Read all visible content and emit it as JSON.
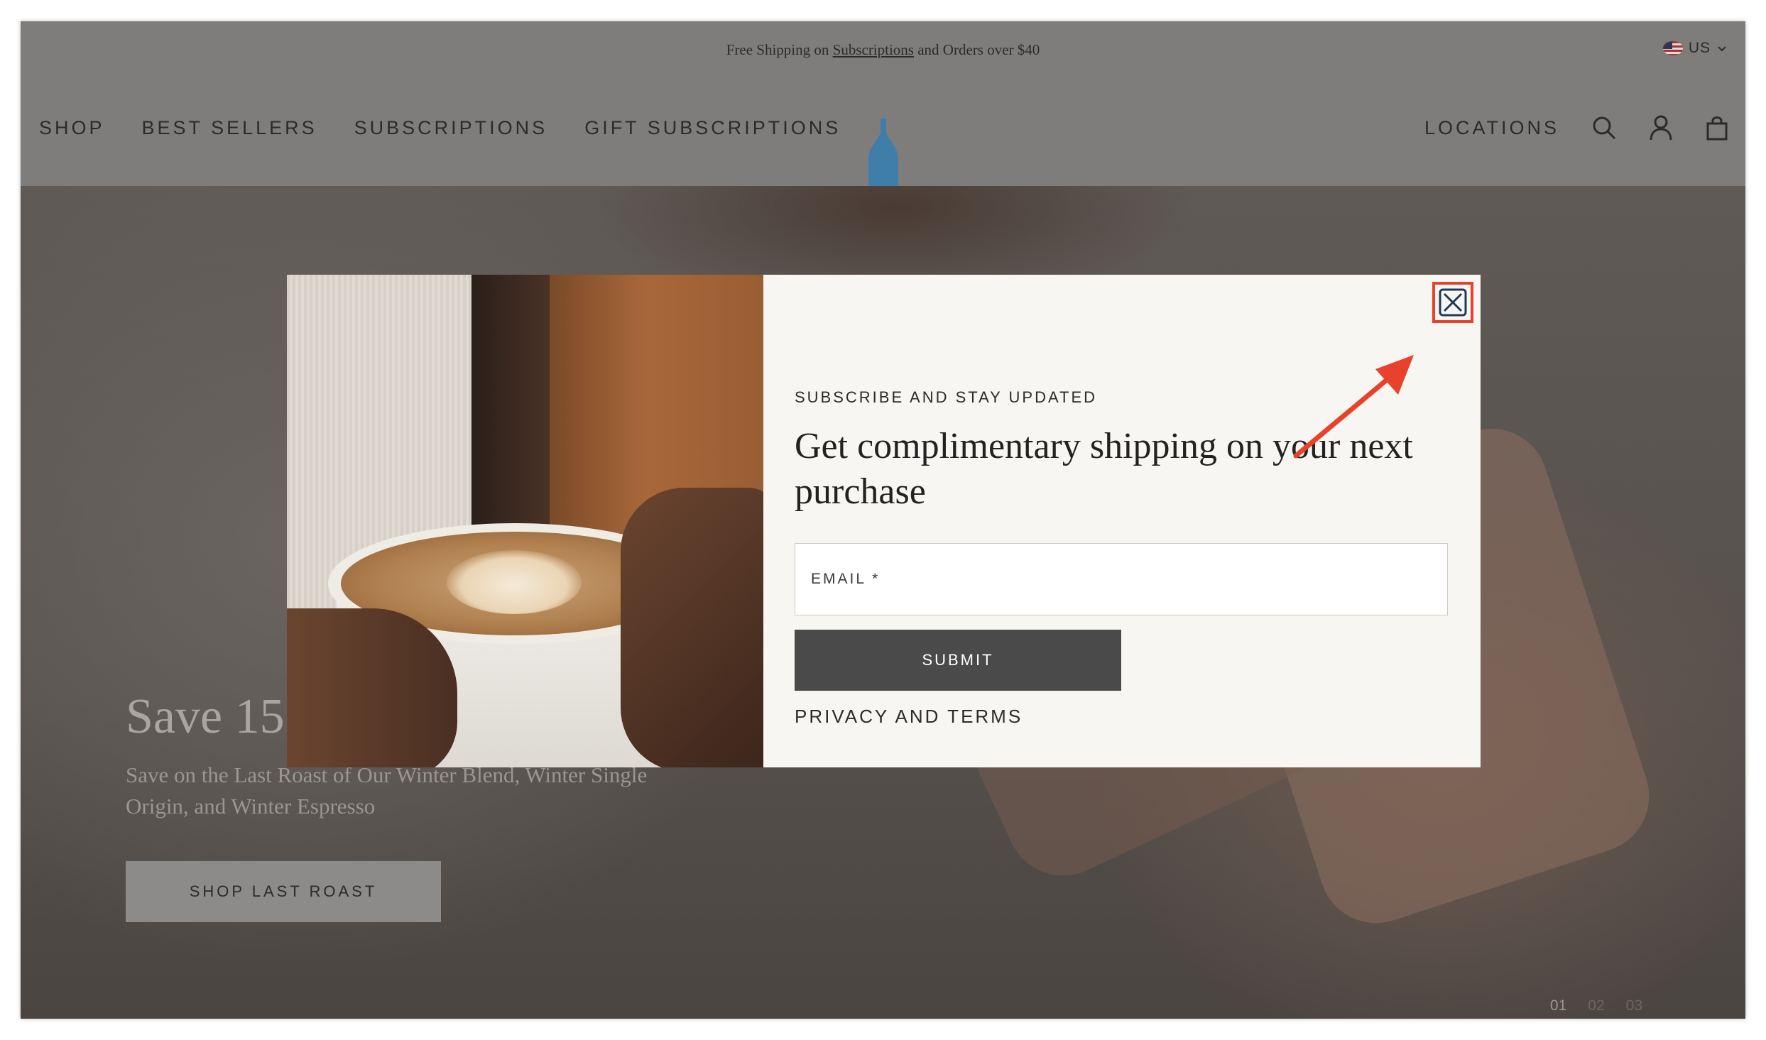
{
  "announcement": {
    "prefix": "Free Shipping on",
    "link": "Subscriptions",
    "suffix": "and Orders over $40"
  },
  "locale": {
    "label": "US",
    "icon": "us-flag-icon"
  },
  "nav": {
    "left": [
      "SHOP",
      "BEST SELLERS",
      "SUBSCRIPTIONS",
      "GIFT SUBSCRIPTIONS"
    ],
    "right_link": "LOCATIONS",
    "icons": [
      "search-icon",
      "account-icon",
      "cart-icon"
    ],
    "logo": "bottle-logo-icon"
  },
  "hero": {
    "title": "Save 15",
    "subtitle": "Save on the Last Roast of Our Winter Blend, Winter Single Origin, and Winter Espresso",
    "button": "SHOP LAST ROAST",
    "pager": [
      "01",
      "02",
      "03"
    ]
  },
  "modal": {
    "eyebrow": "SUBSCRIBE AND STAY UPDATED",
    "headline": "Get complimentary shipping on your next purchase",
    "email_placeholder": "EMAIL *",
    "submit": "SUBMIT",
    "privacy": "PRIVACY AND TERMS",
    "close_icon": "close-icon"
  },
  "colors": {
    "overlay": "#7f7d7b",
    "modal_bg": "#f8f6f2",
    "submit_bg": "#4a4a4a",
    "logo_blue": "#3e7ea8",
    "highlight_red": "#e8412c"
  }
}
